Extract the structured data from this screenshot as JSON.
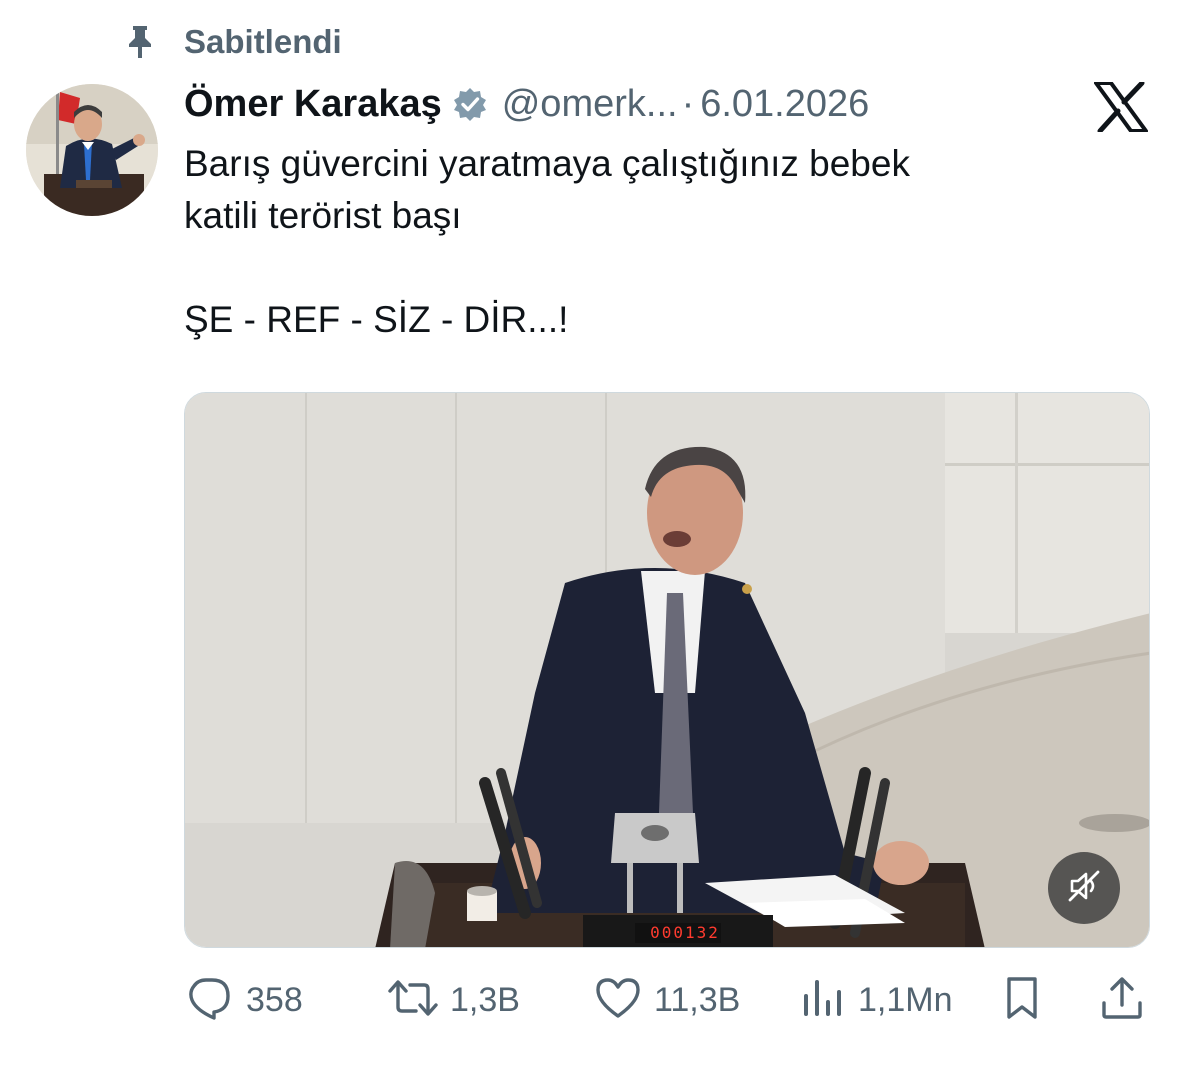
{
  "pinned": {
    "label": "Sabitlendi",
    "icon": "pin-icon"
  },
  "author": {
    "name": "Ömer Karakaş",
    "handle": "@omerk...",
    "separator": "·",
    "date": "6.01.2026",
    "verified": true
  },
  "platform_logo": "x-logo",
  "tweet": {
    "lines": [
      "Barış güvercini yaratmaya çalıştığınız bebek",
      "katili terörist başı",
      "",
      "ŞE - REF - SİZ - DİR...!"
    ]
  },
  "media": {
    "type": "video",
    "timer_display": "000132",
    "mute_icon": "muted-speaker-icon"
  },
  "actions": {
    "reply": {
      "icon": "reply-icon",
      "count": "358"
    },
    "retweet": {
      "icon": "retweet-icon",
      "count": "1,3B"
    },
    "like": {
      "icon": "heart-icon",
      "count": "11,3B"
    },
    "views": {
      "icon": "views-icon",
      "count": "1,1Mn"
    },
    "bookmark": {
      "icon": "bookmark-icon"
    },
    "share": {
      "icon": "share-icon"
    }
  },
  "colors": {
    "text": "#0f1419",
    "secondary": "#536471",
    "verified": "#829aab"
  }
}
